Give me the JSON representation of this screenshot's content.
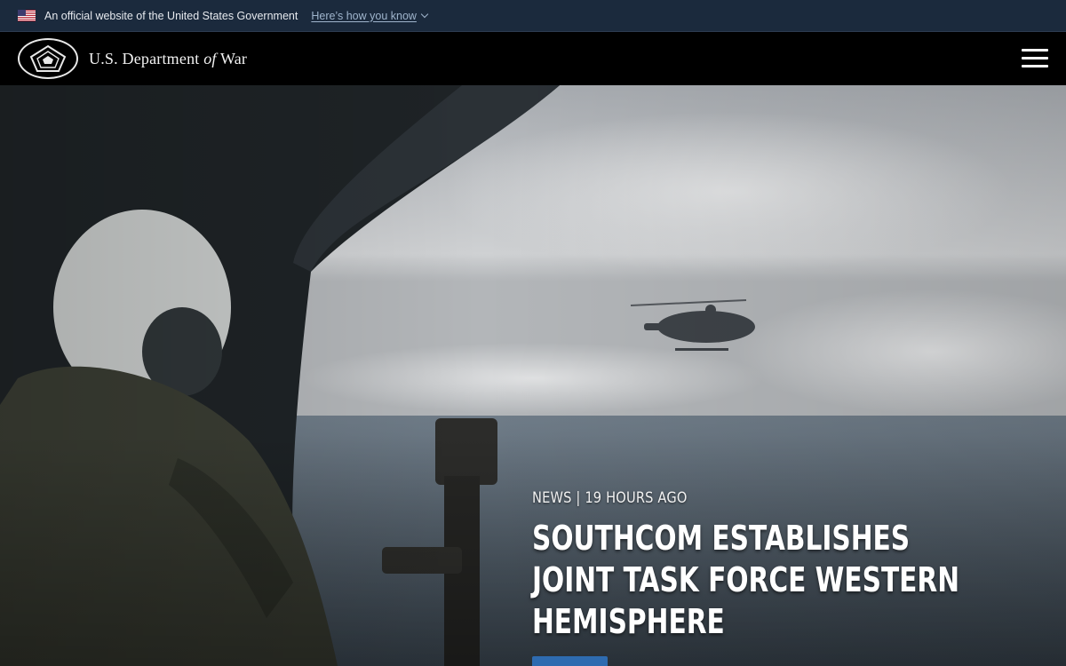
{
  "gov_banner": {
    "official_text": "An official website of the United States Government",
    "how_you_know": "Here’s how you know"
  },
  "header": {
    "brand_prefix": "U.S. Department",
    "brand_of": "of",
    "brand_suffix": "War"
  },
  "hero": {
    "kicker": "NEWS | 19 HOURS AGO",
    "headline": "SOUTHCOM ESTABLISHES JOINT TASK FORCE WESTERN HEMISPHERE"
  },
  "colors": {
    "gov_banner_bg": "#1b2a3d",
    "header_bg": "#000000",
    "accent_button": "#2e6bb0"
  }
}
